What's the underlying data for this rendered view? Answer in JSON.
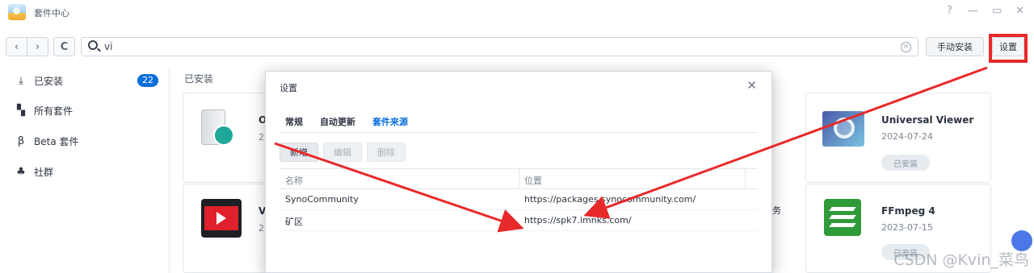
{
  "window": {
    "title": "套件中心",
    "controls": [
      "?",
      "—",
      "▭",
      "✕"
    ]
  },
  "toolbar": {
    "back": "‹",
    "forward": "›",
    "refresh": "C",
    "search_value": "vi",
    "manual_install_label": "手动安装",
    "settings_label": "设置"
  },
  "sidebar": {
    "items": [
      {
        "label": "已安装",
        "icon": "download-icon",
        "badge": "22"
      },
      {
        "label": "所有套件",
        "icon": "grid-icon"
      },
      {
        "label": "Beta 套件",
        "icon": "beta-icon"
      },
      {
        "label": "社群",
        "icon": "community-icon"
      }
    ]
  },
  "main": {
    "section_title": "已安装",
    "cards": [
      {
        "name": "O",
        "date": "2",
        "icon": "safe-key-icon"
      },
      {
        "name": "V",
        "date": "2",
        "icon": "video-player-icon"
      },
      {
        "name": "Universal Viewer",
        "date": "2024-07-24",
        "status": "已安装",
        "icon": "viewer-icon"
      },
      {
        "name": "FFmpeg 4",
        "date": "2023-07-15",
        "status": "已安装",
        "icon": "ffmpeg-icon"
      }
    ],
    "partial_text": "务"
  },
  "dialog": {
    "title": "设置",
    "tabs": [
      "常规",
      "自动更新",
      "套件来源"
    ],
    "active_tab": "套件来源",
    "buttons": {
      "add": "新增",
      "edit": "编辑",
      "delete": "删除"
    },
    "columns": [
      "名称",
      "位置"
    ],
    "rows": [
      {
        "name": "SynoCommunity",
        "location": "https://packages.synocommunity.com/"
      },
      {
        "name": "矿区",
        "location": "https://spk7.imnks.com/"
      }
    ]
  },
  "watermark": "CSDN @Kvin_菜鸟",
  "colors": {
    "accent": "#0a6fdc",
    "annotation_red": "#e8292a"
  }
}
